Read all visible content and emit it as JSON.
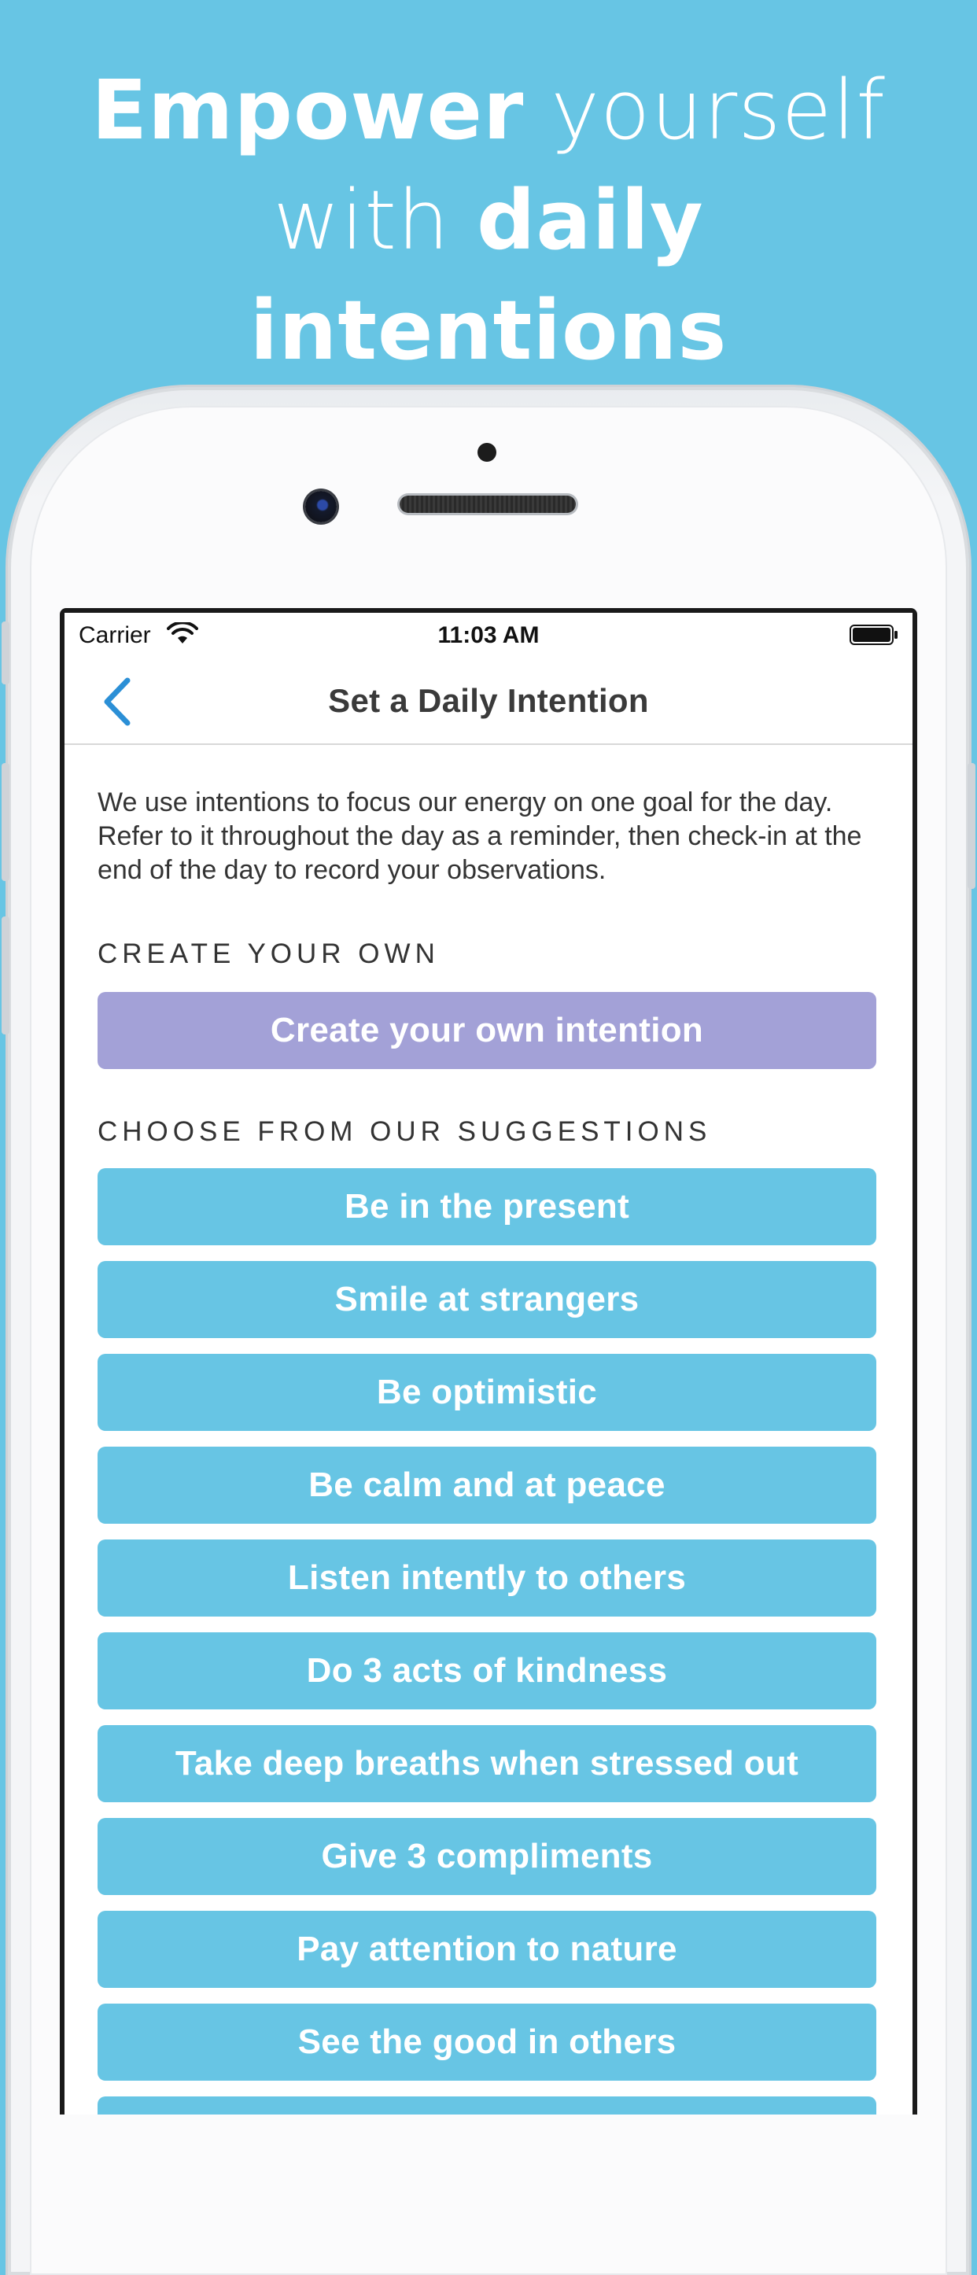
{
  "marketing": {
    "headline_line1_bold": "Empower",
    "headline_line1_light": " yourself",
    "headline_line2_light": "with ",
    "headline_line2_bold": "daily",
    "headline_line3_bold": "intentions"
  },
  "status_bar": {
    "carrier": "Carrier",
    "time": "11:03 AM"
  },
  "nav": {
    "title": "Set a Daily Intention"
  },
  "intro_text": "We use intentions to focus our energy on one goal for the day. Refer to it throughout the day as a reminder, then check-in at the end of the day to record your observations.",
  "create_section": {
    "header": "CREATE YOUR OWN",
    "button_label": "Create your own intention"
  },
  "suggestions_section": {
    "header": "CHOOSE FROM OUR SUGGESTIONS",
    "items": [
      "Be in the present",
      "Smile at strangers",
      "Be optimistic",
      "Be calm and at peace",
      "Listen intently to others",
      "Do 3 acts of kindness",
      "Take deep breaths when stressed out",
      "Give 3 compliments",
      "Pay attention to nature",
      "See the good in others",
      ""
    ]
  },
  "colors": {
    "background": "#67c5e4",
    "create_button": "#a3a1d7",
    "suggestion_button": "#67c5e4",
    "back_chevron": "#2b8fd6"
  }
}
